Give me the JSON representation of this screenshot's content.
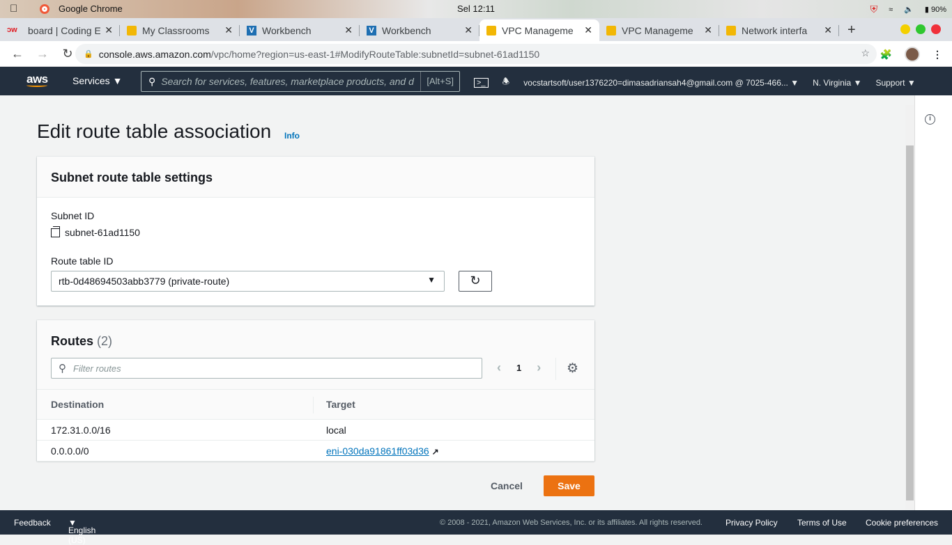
{
  "os": {
    "app_name": "Google Chrome",
    "clock": "Sel 12:11",
    "battery": "90%"
  },
  "browser": {
    "tabs": [
      {
        "title": "board | Coding E",
        "icon": "dw"
      },
      {
        "title": "My Classrooms",
        "icon": "box"
      },
      {
        "title": "Workbench",
        "icon": "v"
      },
      {
        "title": "Workbench",
        "icon": "v"
      },
      {
        "title": "VPC Manageme",
        "icon": "box",
        "active": true
      },
      {
        "title": "VPC Manageme",
        "icon": "box"
      },
      {
        "title": "Network interfa",
        "icon": "box"
      }
    ],
    "url_host": "console.aws.amazon.com",
    "url_path": "/vpc/home?region=us-east-1#ModifyRouteTable:subnetId=subnet-61ad1150"
  },
  "aws": {
    "logo": "aws",
    "services": "Services",
    "search_placeholder": "Search for services, features, marketplace products, and d",
    "search_shortcut": "[Alt+S]",
    "account": "vocstartsoft/user1376220=dimasadriansah4@gmail.com @ 7025-466...",
    "region": "N. Virginia",
    "support": "Support"
  },
  "page": {
    "title": "Edit route table association",
    "info": "Info",
    "settings": {
      "header": "Subnet route table settings",
      "subnet_label": "Subnet ID",
      "subnet_value": "subnet-61ad1150",
      "route_table_label": "Route table ID",
      "route_table_value": "rtb-0d48694503abb3779 (private-route)"
    },
    "routes": {
      "title": "Routes",
      "count": "(2)",
      "filter_placeholder": "Filter routes",
      "page": "1",
      "columns": [
        "Destination",
        "Target"
      ],
      "rows": [
        {
          "destination": "172.31.0.0/16",
          "target": "local"
        },
        {
          "destination": "0.0.0.0/0",
          "target": "eni-030da91861ff03d36"
        }
      ]
    },
    "cancel": "Cancel",
    "save": "Save"
  },
  "footer": {
    "feedback": "Feedback",
    "language": "English (US)",
    "copyright": "© 2008 - 2021, Amazon Web Services, Inc. or its affiliates. All rights reserved.",
    "privacy": "Privacy Policy",
    "terms": "Terms of Use",
    "cookies": "Cookie preferences"
  }
}
